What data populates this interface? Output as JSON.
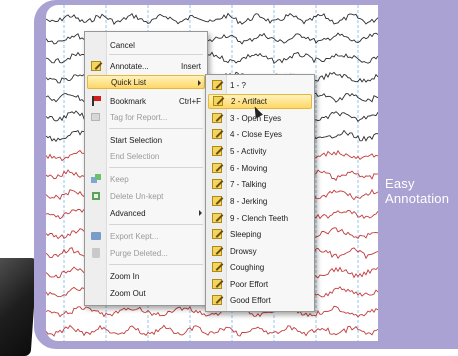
{
  "side_caption": {
    "line1": "Easy",
    "line2": "Annotation"
  },
  "context_menu": {
    "items": [
      {
        "label": "Cancel",
        "shortcut": "",
        "icon": "none",
        "disabled": false
      },
      {
        "label": "Annotate...",
        "shortcut": "Insert",
        "icon": "note-icon",
        "disabled": false
      },
      {
        "label": "Quick List",
        "shortcut": "",
        "icon": "none",
        "disabled": false,
        "submenu": true,
        "highlighted": true
      },
      {
        "label": "Bookmark",
        "shortcut": "Ctrl+F",
        "icon": "bookmark-flag-icon",
        "disabled": false
      },
      {
        "label": "Tag for Report...",
        "shortcut": "",
        "icon": "tag-icon",
        "disabled": true
      },
      {
        "label": "Start Selection",
        "shortcut": "",
        "icon": "none",
        "disabled": false
      },
      {
        "label": "End Selection",
        "shortcut": "",
        "icon": "none",
        "disabled": true
      },
      {
        "label": "Keep",
        "shortcut": "",
        "icon": "keep-icon",
        "disabled": true
      },
      {
        "label": "Delete Un-kept",
        "shortcut": "",
        "icon": "delete-unkept-icon",
        "disabled": true
      },
      {
        "label": "Advanced",
        "shortcut": "",
        "icon": "none",
        "disabled": false,
        "submenu": true
      },
      {
        "label": "Export Kept...",
        "shortcut": "",
        "icon": "export-icon",
        "disabled": true
      },
      {
        "label": "Purge Deleted...",
        "shortcut": "",
        "icon": "purge-icon",
        "disabled": true
      },
      {
        "label": "Zoom In",
        "shortcut": "",
        "icon": "none",
        "disabled": false
      },
      {
        "label": "Zoom Out",
        "shortcut": "",
        "icon": "none",
        "disabled": false
      }
    ]
  },
  "quick_list": {
    "items": [
      "1 - ?",
      "2 - Artifact",
      "3 - Open Eyes",
      "4 - Close Eyes",
      "5 - Activity",
      "6 - Moving",
      "7 - Talking",
      "8 - Jerking",
      "9 - Clench Teeth",
      "Sleeping",
      "Drowsy",
      "Coughing",
      "Poor Effort",
      "Good Effort"
    ],
    "highlighted_index": 1
  },
  "colors": {
    "panel": "#a9a2d3",
    "trace_black": "#2b2b2b",
    "trace_red": "#c23a3a",
    "grid_blue": "#7ab7e6",
    "highlight": "#ffd767"
  }
}
